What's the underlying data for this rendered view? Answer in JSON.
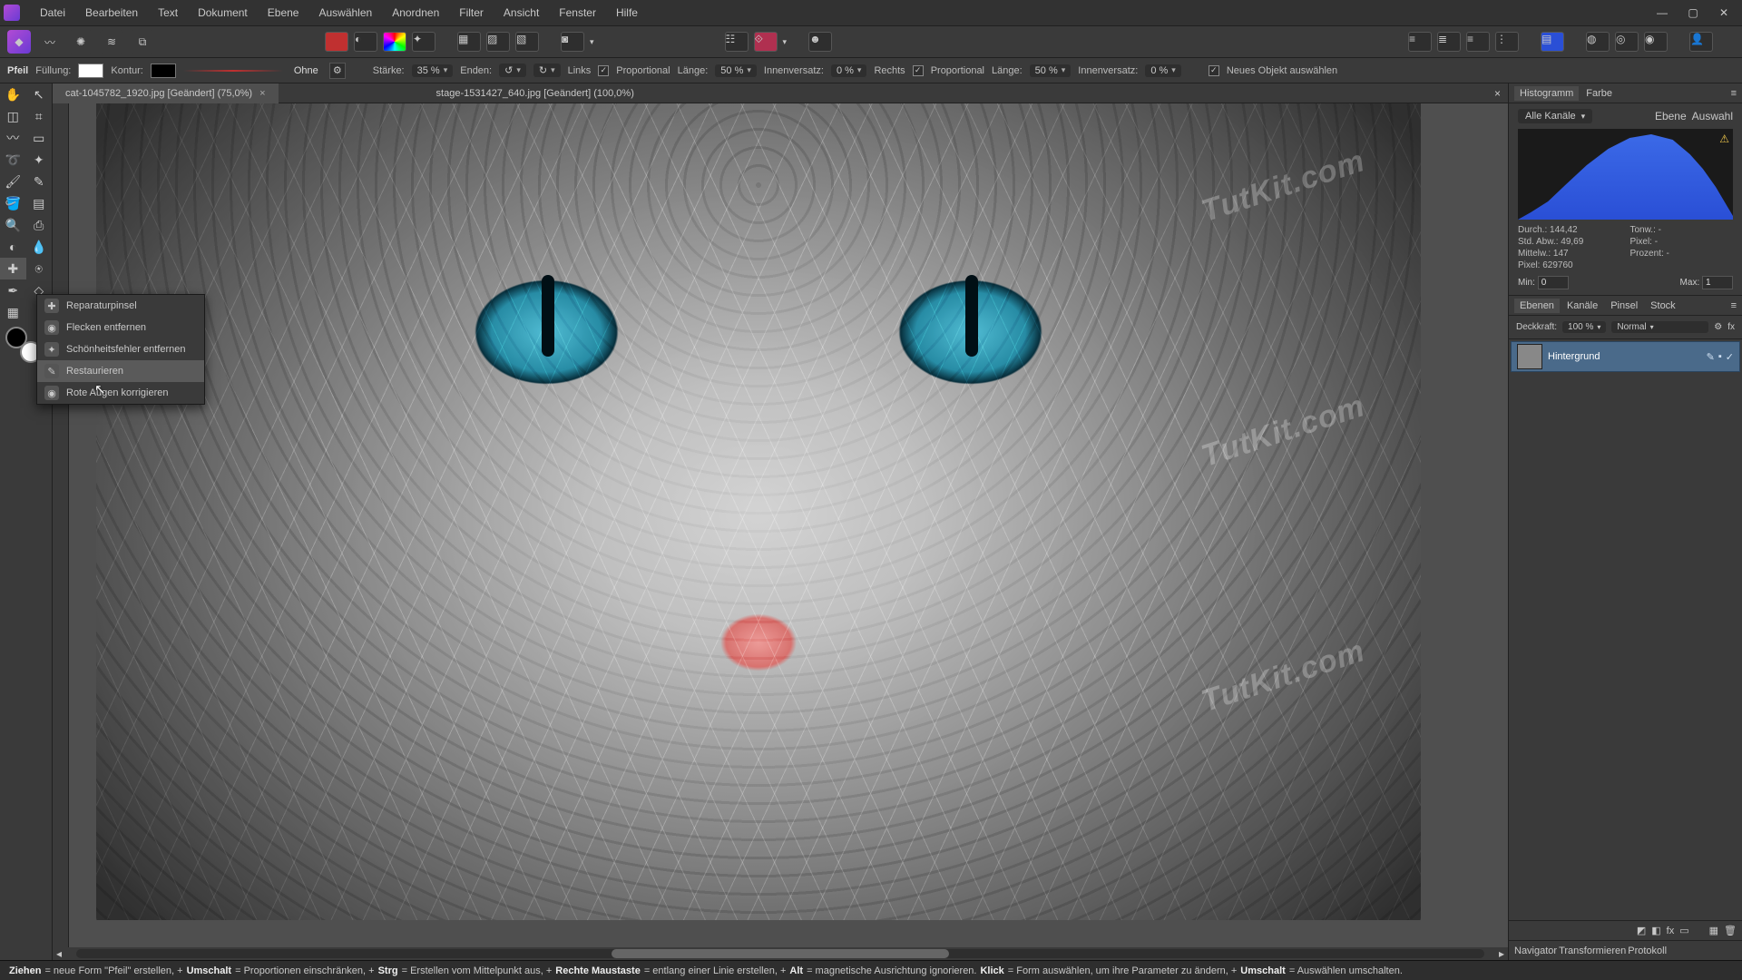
{
  "menu": {
    "items": [
      "Datei",
      "Bearbeiten",
      "Text",
      "Dokument",
      "Ebene",
      "Auswählen",
      "Anordnen",
      "Filter",
      "Ansicht",
      "Fenster",
      "Hilfe"
    ]
  },
  "window_controls": {
    "min": "—",
    "max": "▢",
    "close": "✕"
  },
  "options": {
    "tool": "Pfeil",
    "fill_label": "Füllung:",
    "stroke_label": "Kontur:",
    "none_label": "Ohne",
    "strength_label": "Stärke:",
    "strength_value": "35 %",
    "ends_label": "Enden:",
    "links_label": "Links",
    "prop_label": "Proportional",
    "length_label": "Länge:",
    "length_left": "50 %",
    "inset_label": "Innenversatz:",
    "inset_left": "0 %",
    "rechts_label": "Rechts",
    "length_right": "50 %",
    "inset_right": "0 %",
    "newobj_label": "Neues Objekt auswählen"
  },
  "tabs": [
    {
      "label": "cat-1045782_1920.jpg [Geändert] (75,0%)",
      "active": true
    },
    {
      "label": "stage-1531427_640.jpg [Geändert] (100,0%)",
      "active": false
    }
  ],
  "flyout": {
    "items": [
      {
        "label": "Reparaturpinsel"
      },
      {
        "label": "Flecken entfernen"
      },
      {
        "label": "Schönheitsfehler entfernen"
      },
      {
        "label": "Restaurieren",
        "hl": true
      },
      {
        "label": "Rote Augen korrigieren"
      }
    ]
  },
  "watermark": "TutKit.com",
  "right": {
    "hist_tab": "Histogramm",
    "color_tab": "Farbe",
    "channel_sel": "Alle Kanäle",
    "ebene_btn": "Ebene",
    "auswahl_btn": "Auswahl",
    "stats": {
      "durch": "Durch.: 144,42",
      "stdabw": "Std. Abw.: 49,69",
      "mittelw": "Mittelw.: 147",
      "pixel": "Pixel: 629760",
      "tonw": "Tonw.: -",
      "pixel2": "Pixel: -",
      "prozent": "Prozent: -"
    },
    "min_label": "Min:",
    "min_val": "0",
    "max_label": "Max:",
    "max_val": "1",
    "layer_tabs": [
      "Ebenen",
      "Kanäle",
      "Pinsel",
      "Stock"
    ],
    "opacity_label": "Deckkraft:",
    "opacity_val": "100 %",
    "blend_val": "Normal",
    "layer_name": "Hintergrund",
    "nav_tabs": [
      "Navigator",
      "Transformieren",
      "Protokoll"
    ]
  },
  "status": {
    "parts": [
      {
        "b": "Ziehen"
      },
      {
        "t": " = neue Form \"Pfeil\" erstellen, +"
      },
      {
        "b": "Umschalt"
      },
      {
        "t": " = Proportionen einschränken, +"
      },
      {
        "b": "Strg"
      },
      {
        "t": " = Erstellen vom Mittelpunkt aus, +"
      },
      {
        "b": "Rechte Maustaste"
      },
      {
        "t": " = entlang einer Linie erstellen, +"
      },
      {
        "b": "Alt"
      },
      {
        "t": " = magnetische Ausrichtung ignorieren. "
      },
      {
        "b": "Klick"
      },
      {
        "t": " = Form auswählen, um ihre Parameter zu ändern, +"
      },
      {
        "b": "Umschalt"
      },
      {
        "t": " = Auswählen umschalten."
      }
    ]
  },
  "chart_data": {
    "type": "area",
    "title": "Histogramm",
    "xlabel": "",
    "ylabel": "",
    "xlim": [
      0,
      255
    ],
    "series": [
      {
        "name": "Alle Kanäle",
        "x": [
          0,
          20,
          40,
          60,
          80,
          100,
          120,
          140,
          147,
          160,
          180,
          200,
          220,
          240,
          255
        ],
        "values": [
          2,
          6,
          14,
          26,
          44,
          66,
          84,
          94,
          96,
          92,
          76,
          54,
          32,
          14,
          4
        ]
      }
    ],
    "stats": {
      "mean": 144.42,
      "stddev": 49.69,
      "median": 147,
      "pixels": 629760
    },
    "min": 0,
    "max": 1
  }
}
